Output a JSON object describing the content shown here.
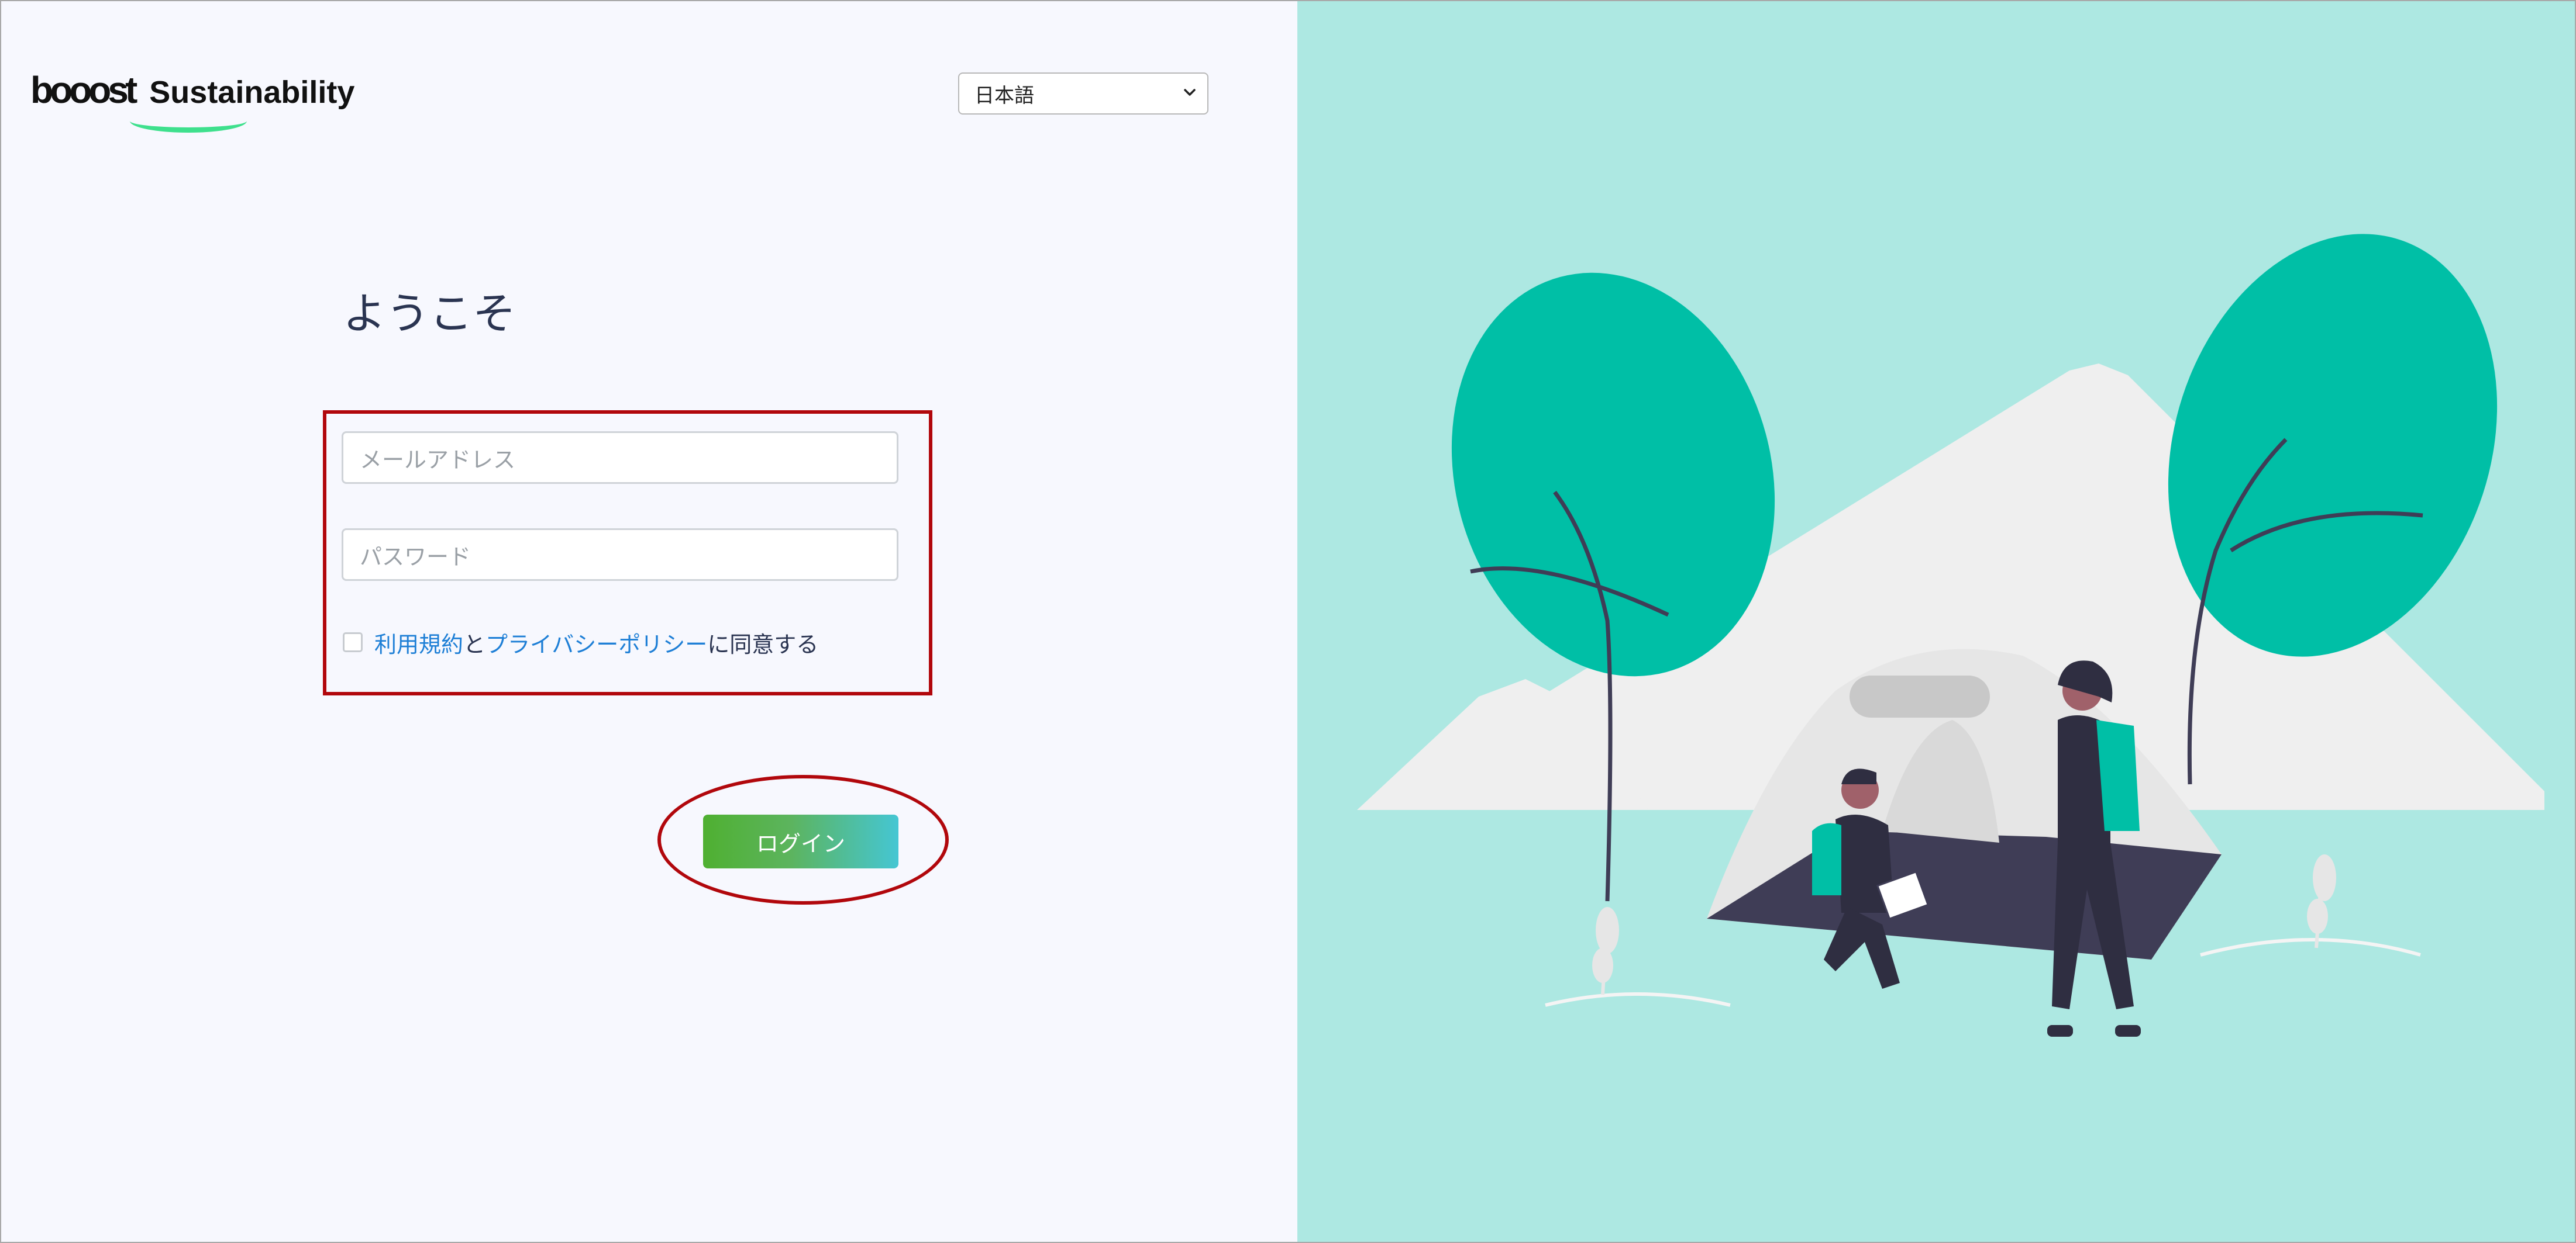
{
  "brand": {
    "logo_word": "booost",
    "product": "Sustainability"
  },
  "language_select": {
    "selected": "日本語"
  },
  "login_form": {
    "heading": "ようこそ",
    "email_placeholder": "メールアドレス",
    "password_placeholder": "パスワード",
    "agree": {
      "terms_link": "利用規約",
      "and_text": "と",
      "privacy_link": "プライバシーポリシー",
      "suffix": "に同意する",
      "checked": false
    },
    "login_label": "ログイン"
  },
  "colors": {
    "left_background": "#f7f8fe",
    "right_background": "#ade8e2",
    "accent_teal": "#00bfa6",
    "link": "#1e7fd6",
    "annotation_red": "#b1070c",
    "button_gradient_start": "#4fb031",
    "button_gradient_end": "#45c6d3"
  }
}
